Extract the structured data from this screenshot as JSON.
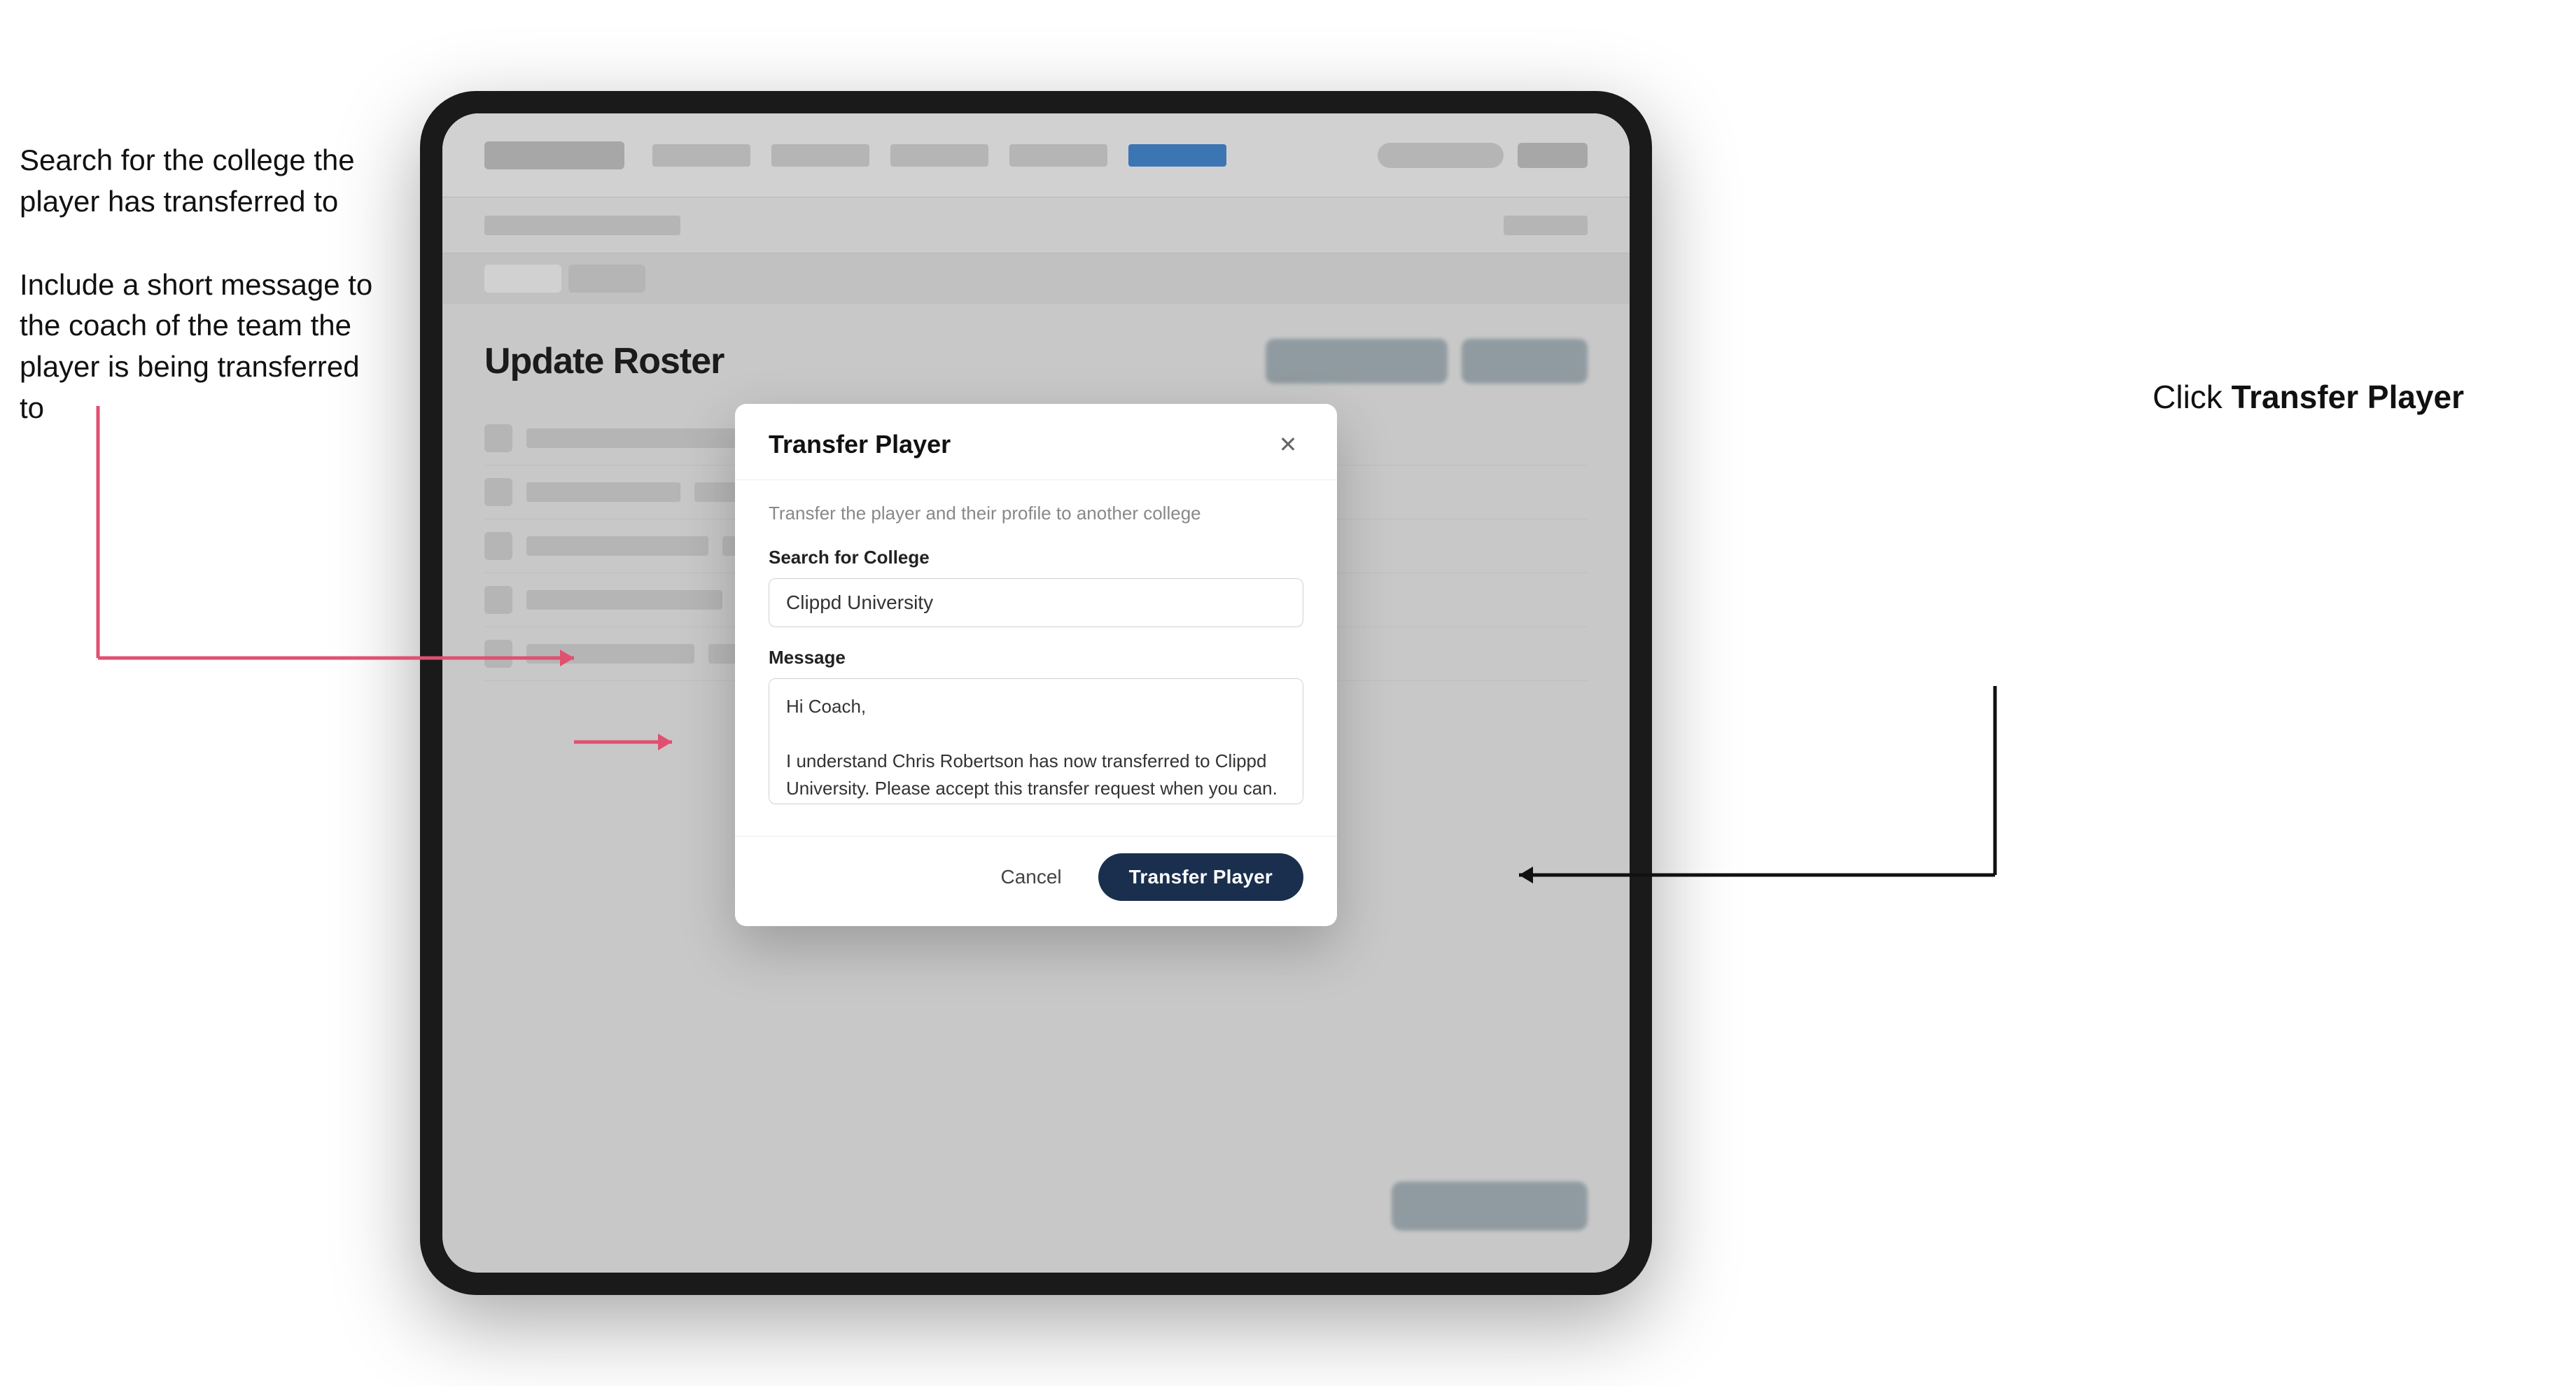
{
  "annotations": {
    "left_title1": "Search for the college the player has transferred to",
    "left_title2": "Include a short message to the coach of the team the player is being transferred to",
    "right_label": "Click ",
    "right_bold": "Transfer Player"
  },
  "app": {
    "page_title": "Update Roster",
    "modal": {
      "title": "Transfer Player",
      "subtitle": "Transfer the player and their profile to another college",
      "search_label": "Search for College",
      "search_value": "Clippd University",
      "message_label": "Message",
      "message_value": "Hi Coach,\n\nI understand Chris Robertson has now transferred to Clippd University. Please accept this transfer request when you can.",
      "cancel_label": "Cancel",
      "transfer_label": "Transfer Player"
    }
  }
}
